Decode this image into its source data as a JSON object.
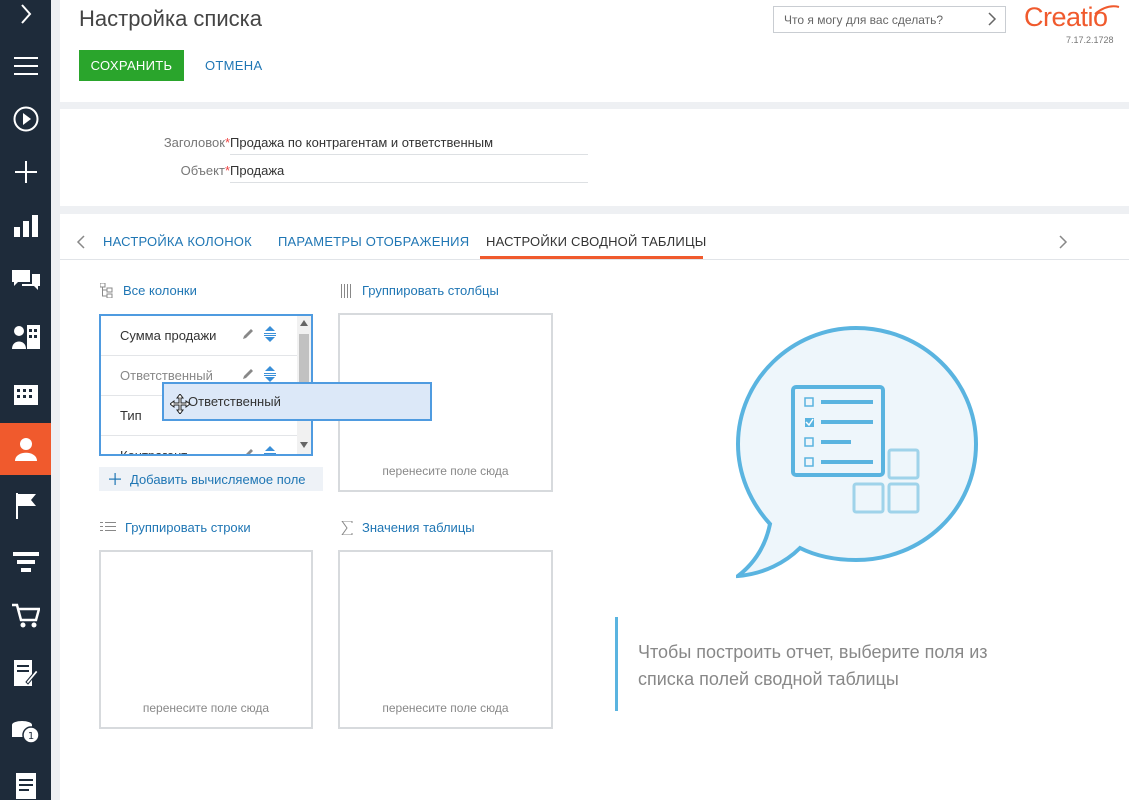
{
  "nav": {
    "items": [
      {
        "icon": "chevron-right-icon"
      },
      {
        "icon": "menu-icon"
      },
      {
        "icon": "play-icon"
      },
      {
        "icon": "plus-icon"
      },
      {
        "icon": "dashboard-icon"
      },
      {
        "icon": "chat-icon"
      },
      {
        "icon": "contacts-icon"
      },
      {
        "icon": "accounts-icon"
      },
      {
        "icon": "person-icon"
      },
      {
        "icon": "flag-icon"
      },
      {
        "icon": "funnel-icon"
      },
      {
        "icon": "cart-icon"
      },
      {
        "icon": "document-edit-icon"
      },
      {
        "icon": "coins-icon"
      },
      {
        "icon": "document-icon"
      }
    ],
    "active_index": 8,
    "colors": {
      "background": "#1e2b3a",
      "active": "#f05a2d"
    }
  },
  "header": {
    "title": "Настройка списка",
    "save_label": "СОХРАНИТЬ",
    "cancel_label": "ОТМЕНА",
    "search_placeholder": "Что я могу для вас сделать?",
    "logo_text": "Creatio",
    "version": "7.17.2.1728"
  },
  "fields": {
    "caption_label": "Заголовок",
    "caption_value": "Продажа по контрагентам и ответственным",
    "object_label": "Объект",
    "object_value": "Продажа",
    "required_mark": "*"
  },
  "tabs": {
    "items": [
      {
        "label": "НАСТРОЙКА КОЛОНОК"
      },
      {
        "label": "ПАРАМЕТРЫ ОТОБРАЖЕНИЯ"
      },
      {
        "label": "НАСТРОЙКИ СВОДНОЙ ТАБЛИЦЫ"
      }
    ],
    "active_index": 2
  },
  "pivot": {
    "all_columns_label": "Все колонки",
    "group_columns_label": "Группировать столбцы",
    "group_rows_label": "Группировать строки",
    "values_label": "Значения таблицы",
    "drop_hint": "перенесите поле сюда",
    "columns": [
      {
        "label": "Сумма продажи"
      },
      {
        "label": "Ответственный"
      },
      {
        "label": "Тип"
      },
      {
        "label": "Контрагент"
      }
    ],
    "drag_item_label": "Ответственный",
    "add_computed_label": "Добавить вычисляемое поле"
  },
  "empty_state": {
    "message_line1": "Чтобы построить отчет, выберите поля из",
    "message_line2": "списка полей сводной таблицы"
  },
  "colors": {
    "accent": "#f05a2d",
    "save": "#2aa52c",
    "link": "#1f76b4",
    "illustration": "#5ab4e0"
  }
}
